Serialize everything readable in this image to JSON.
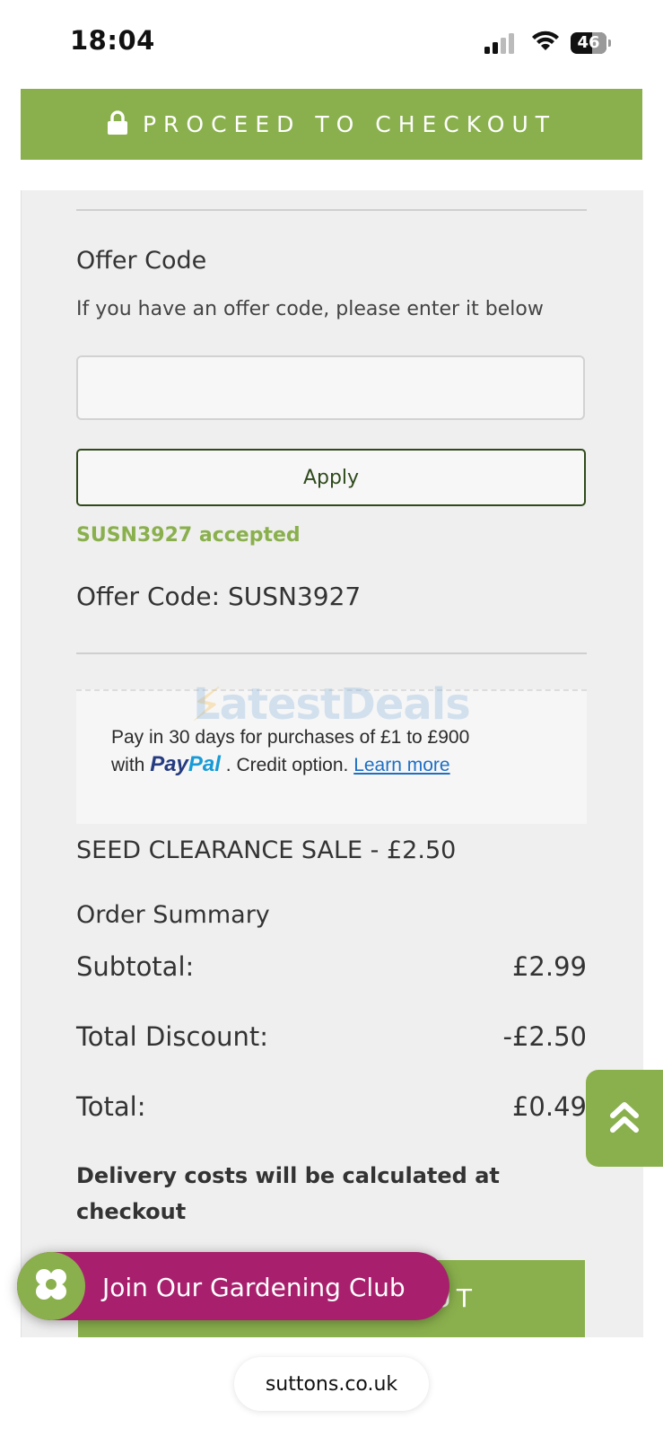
{
  "status_bar": {
    "time": "18:04",
    "battery": "46"
  },
  "top_checkout": {
    "label": "PROCEED TO CHECKOUT",
    "icon": "lock-icon"
  },
  "offer": {
    "heading": "Offer Code",
    "description": "If you have an offer code, please enter it below",
    "input_value": "",
    "apply_label": "Apply",
    "accepted_message": "SUSN3927 accepted",
    "applied_line": "Offer Code: SUSN3927"
  },
  "paypal": {
    "line1": "Pay in 30 days for purchases of £1 to £900",
    "line2_prefix": "with",
    "logo_pay": "Pay",
    "logo_pal": "Pal",
    "line2_suffix": ". Credit option.",
    "learn_more": "Learn more"
  },
  "watermark": "LatestDeals",
  "sale_line": "SEED CLEARANCE SALE - £2.50",
  "order_summary": {
    "title": "Order Summary",
    "rows": [
      {
        "label": "Subtotal:",
        "value": "£2.99"
      },
      {
        "label": "Total Discount:",
        "value": "-£2.50"
      },
      {
        "label": "Total:",
        "value": "£0.49"
      }
    ],
    "delivery_note": "Delivery costs will be calculated at checkout"
  },
  "bottom_checkout": {
    "visible_text": "UT"
  },
  "club": {
    "label": "Join Our Gardening Club",
    "icon": "flower-icon"
  },
  "scroll_top": {
    "icon": "double-chevron-up-icon"
  },
  "browser": {
    "url": "suttons.co.uk"
  },
  "colors": {
    "brand_green": "#8ab04d",
    "club_magenta": "#a8206d",
    "panel_bg": "#efefef",
    "dark_green": "#2f4a1c"
  }
}
